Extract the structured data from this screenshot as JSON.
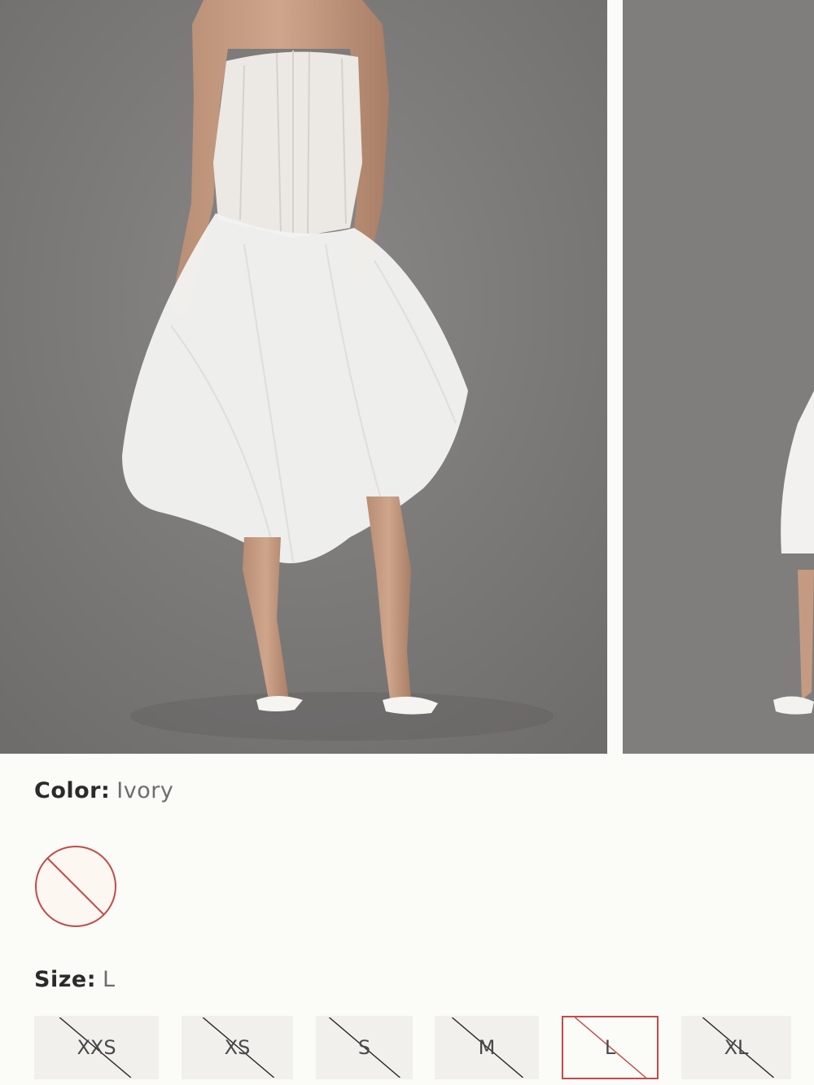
{
  "product": {
    "color_label": "Color:",
    "color_value": "Ivory",
    "size_label": "Size:",
    "size_value": "L"
  },
  "gallery": {
    "slides": [
      "model-front-photo",
      "model-side-photo"
    ]
  },
  "swatches": [
    {
      "name": "Ivory",
      "available": false,
      "selected": true,
      "color": "#fdf7f2"
    }
  ],
  "sizes": [
    {
      "label": "XXS",
      "available": false,
      "selected": false
    },
    {
      "label": "XS",
      "available": false,
      "selected": false
    },
    {
      "label": "S",
      "available": false,
      "selected": false
    },
    {
      "label": "M",
      "available": false,
      "selected": false
    },
    {
      "label": "L",
      "available": false,
      "selected": true
    },
    {
      "label": "XL",
      "available": false,
      "selected": false
    }
  ],
  "colors": {
    "background": "#fbfbf7",
    "unavailable_accent": "#c24a4a",
    "size_tile": "#f1f0ec",
    "photo_backdrop": "#7d7b7a"
  }
}
